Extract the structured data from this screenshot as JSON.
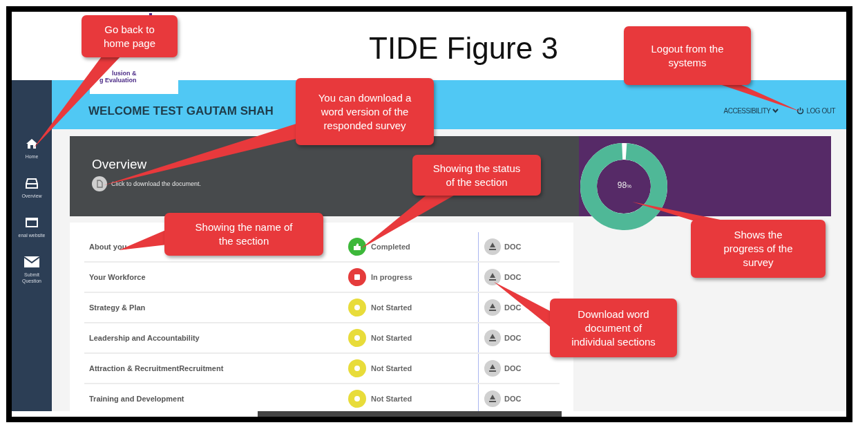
{
  "figure_title": "TIDE Figure 3",
  "logo": {
    "lines": [
      "lusion &",
      "g Evaluation"
    ]
  },
  "header": {
    "welcome": "WELCOME TEST GAUTAM SHAH",
    "accessibility": "ACCESSIBILITY",
    "logout": "LOG OUT"
  },
  "sidebar": {
    "items": [
      {
        "kind": "home",
        "label": "Home"
      },
      {
        "kind": "overview",
        "label": "Overview"
      },
      {
        "kind": "website",
        "label": "enal website"
      },
      {
        "kind": "mail",
        "label": "Submit Question"
      }
    ]
  },
  "overview": {
    "title": "Overview",
    "download_link": "Click to download the document."
  },
  "progress": {
    "value": "98",
    "unit": "%",
    "level": 0.98
  },
  "sections": [
    {
      "name": "About you",
      "kind": "completed",
      "status": "Completed",
      "doc": "DOC"
    },
    {
      "name": "Your Workforce",
      "kind": "in_progress",
      "status": "In progress",
      "doc": "DOC"
    },
    {
      "name": "Strategy & Plan",
      "kind": "not_started",
      "status": "Not Started",
      "doc": "DOC"
    },
    {
      "name": "Leadership and Accountability",
      "kind": "not_started",
      "status": "Not Started",
      "doc": "DOC"
    },
    {
      "name": "Attraction & RecruitmentRecruitment",
      "kind": "not_started",
      "status": "Not Started",
      "doc": "DOC"
    },
    {
      "name": "Training and Development",
      "kind": "not_started",
      "status": "Not Started",
      "doc": "DOC"
    }
  ],
  "callouts": [
    "Go back to home page",
    "You can download a word version of the responded survey",
    "Showing the status of the section",
    "Showing the name of the section",
    "Logout from the systems",
    "Shows the progress of the survey",
    "Download word document of individual sections"
  ]
}
